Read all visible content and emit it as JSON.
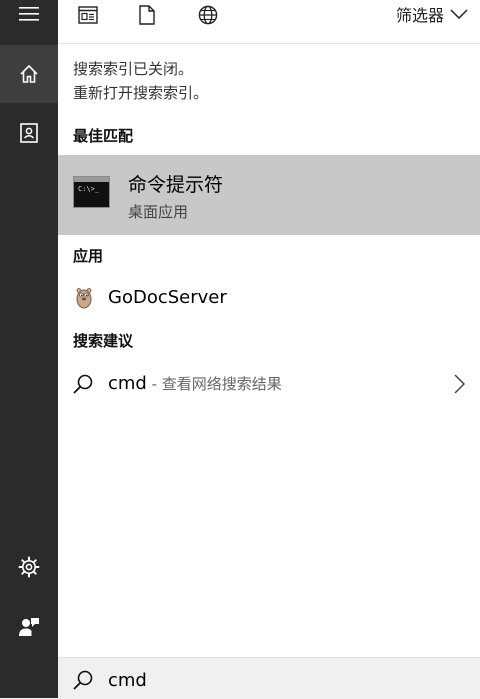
{
  "sidebar": {
    "items": [
      {
        "name": "menu",
        "icon": "hamburger-icon"
      },
      {
        "name": "home",
        "icon": "home-icon",
        "active": true
      },
      {
        "name": "notebook",
        "icon": "notebook-icon"
      },
      {
        "name": "settings",
        "icon": "gear-icon"
      },
      {
        "name": "feedback",
        "icon": "feedback-icon"
      }
    ]
  },
  "topbar": {
    "icons": [
      "apps-icon",
      "document-icon",
      "web-icon"
    ],
    "filter_label": "筛选器"
  },
  "notice": {
    "line1": "搜索索引已关闭。",
    "line2": "重新打开搜索索引。"
  },
  "sections": {
    "best_match": "最佳匹配",
    "apps": "应用",
    "suggestions": "搜索建议"
  },
  "best_match": {
    "title": "命令提示符",
    "subtitle": "桌面应用",
    "icon_prompt": "C:\\>_"
  },
  "apps": [
    {
      "label": "GoDocServer",
      "icon": "gopher-icon"
    }
  ],
  "suggestions": [
    {
      "query": "cmd",
      "sub": " - 查看网络搜索结果"
    }
  ],
  "search": {
    "value": "cmd"
  },
  "colors": {
    "sidebar_bg": "#2b2b2b",
    "sidebar_active": "#3e3e3e",
    "selected_row": "#c8c8c8",
    "searchbox_bg": "#f0f0f0"
  }
}
